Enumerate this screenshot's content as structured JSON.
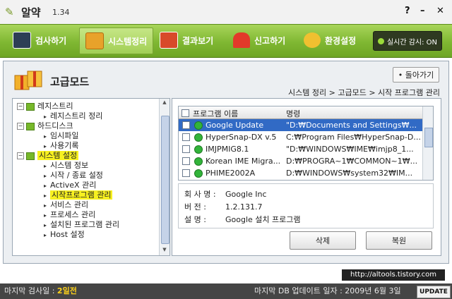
{
  "window": {
    "app_name": "알약",
    "version": "1.34",
    "help": "?",
    "minimize": "–",
    "close": "✕"
  },
  "toolbar": {
    "items": [
      {
        "label": "검사하기",
        "icon": "monitor-search-icon"
      },
      {
        "label": "시스템정리",
        "icon": "gift-box-icon"
      },
      {
        "label": "결과보기",
        "icon": "chart-window-icon"
      },
      {
        "label": "신고하기",
        "icon": "siren-icon"
      },
      {
        "label": "환경설정",
        "icon": "gears-icon"
      }
    ],
    "active_index": 1,
    "realtime": "실시간 감시: ON"
  },
  "page": {
    "title": "고급모드",
    "back_button": "• 돌아가기",
    "breadcrumb": "시스템 정리 > 고급모드 > 시작 프로그램 관리"
  },
  "tree": [
    {
      "label": "레지스트리",
      "level": 0
    },
    {
      "label": "레지스트리 정리",
      "level": 1
    },
    {
      "label": "하드디스크",
      "level": 0
    },
    {
      "label": "임시파일",
      "level": 1
    },
    {
      "label": "사용기록",
      "level": 1
    },
    {
      "label": "시스템 설정",
      "level": 0,
      "highlight": true
    },
    {
      "label": "시스템 정보",
      "level": 1
    },
    {
      "label": "시작 / 종료 설정",
      "level": 1
    },
    {
      "label": "ActiveX 관리",
      "level": 1
    },
    {
      "label": "시작프로그램 관리",
      "level": 1,
      "highlight": true
    },
    {
      "label": "서비스 관리",
      "level": 1
    },
    {
      "label": "프로세스 관리",
      "level": 1
    },
    {
      "label": "설치된 프로그램 관리",
      "level": 1
    },
    {
      "label": "Host 설정",
      "level": 1
    }
  ],
  "list": {
    "columns": [
      "프로그램 이름",
      "명령"
    ],
    "rows": [
      {
        "name": "Google Update",
        "command": "\"D:₩Documents and Settings₩...",
        "selected": true
      },
      {
        "name": "HyperSnap-DX v.5",
        "command": "C:₩Program Files₩HyperSnap-D..."
      },
      {
        "name": "IMJPMIG8.1",
        "command": "\"D:₩WINDOWS₩IME₩imjp8_1..."
      },
      {
        "name": "Korean IME Migra...",
        "command": "D:₩PROGRA~1₩COMMON~1₩..."
      },
      {
        "name": "PHIME2002A",
        "command": "D:₩WINDOWS₩system32₩IM..."
      }
    ]
  },
  "details": {
    "company_label": "회 사 명 :",
    "company": "Google Inc",
    "version_label": "버     전 :",
    "version": "1.2.131.7",
    "desc_label": "설     명 :",
    "desc": "Google 설치 프로그램"
  },
  "buttons": {
    "delete": "삭제",
    "restore": "복원"
  },
  "url": "http://altools.tistory.com",
  "status": {
    "last_scan_label": "마지막 검사일 :",
    "last_scan": "2일전",
    "db_update": "마지막 DB 업데이트 일자 : 2009년 6월 3일",
    "update_button": "UPDATE"
  }
}
